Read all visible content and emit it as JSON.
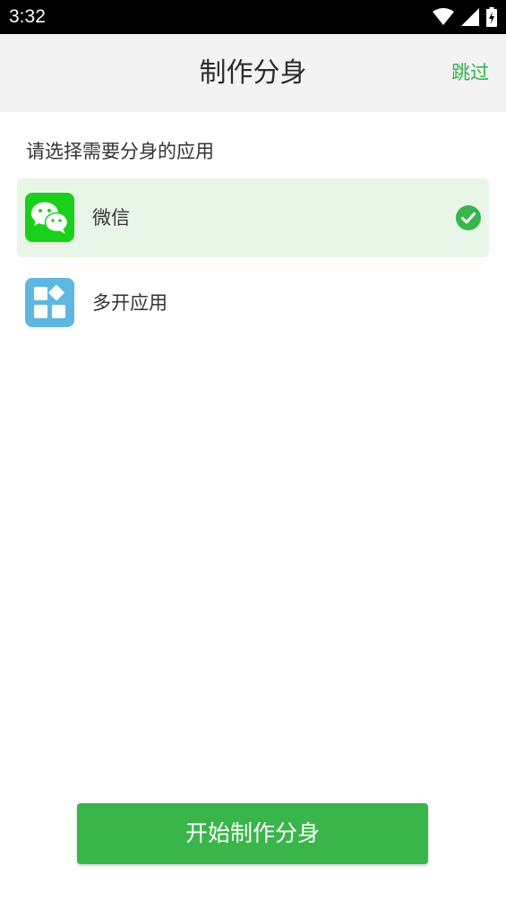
{
  "status_bar": {
    "time": "3:32",
    "icons": [
      "wifi-icon",
      "cellular-signal-icon",
      "battery-charging-icon"
    ]
  },
  "header": {
    "title": "制作分身",
    "skip_label": "跳过"
  },
  "section_label": "请选择需要分身的应用",
  "apps": [
    {
      "name": "微信",
      "icon": "wechat-icon",
      "selected": true
    },
    {
      "name": "多开应用",
      "icon": "multi-app-icon",
      "selected": false
    }
  ],
  "start_button_label": "开始制作分身",
  "colors": {
    "accent": "#39b54a",
    "skip_text": "#2fb14a",
    "selected_bg": "#e7f6e7",
    "header_bg": "#f3f3f3",
    "multi_app_icon_bg": "#5fb7e1"
  }
}
